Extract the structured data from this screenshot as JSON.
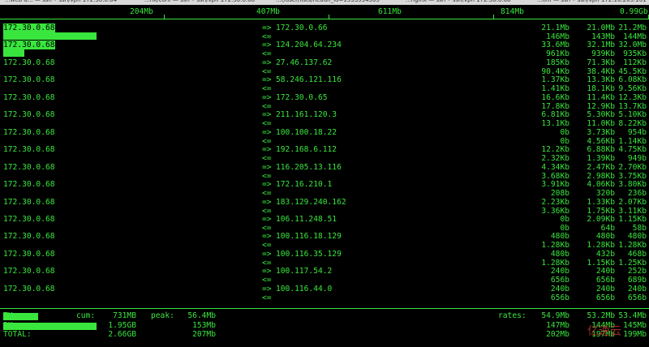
{
  "tabs": [
    "...web-a... — ssh • ssh/vpn 172.30.0.64",
    "...nx/conf — ssh • ssh/vpn 172.30.0.68",
    "...(/user/lists/headn_id=1533534305",
    "...nginx — ssh • ssh/vpn 172.30.0.68",
    "...onf — ssh • ssh/vpn 172.16.209.101"
  ],
  "scale": [
    "204Mb",
    "407Mb",
    "611Mb",
    "814Mb",
    "0.99Gb"
  ],
  "arrows": {
    "out": "=>",
    "in": "<="
  },
  "hosts": [
    {
      "src": "172.30.0.68",
      "dst": "172.30.0.66",
      "tx": [
        "21.1Mb",
        "21.0Mb",
        "21.2Mb"
      ],
      "rx": [
        "146Mb",
        "143Mb",
        "144Mb"
      ],
      "bar": 0.144
    },
    {
      "src": "172.30.0.68",
      "dst": "124.204.64.234",
      "tx": [
        "33.6Mb",
        "32.1Mb",
        "32.0Mb"
      ],
      "rx": [
        "961Kb",
        "939Kb",
        "935Kb"
      ],
      "bar": 0.033
    },
    {
      "src": "172.30.0.68",
      "dst": "27.46.137.62",
      "tx": [
        "185Kb",
        "71.3Kb",
        "112Kb"
      ],
      "rx": [
        "90.4Kb",
        "38.4Kb",
        "45.5Kb"
      ],
      "bar": 0
    },
    {
      "src": "172.30.0.68",
      "dst": "58.246.121.116",
      "tx": [
        "1.37Kb",
        "13.3Kb",
        "6.08Kb"
      ],
      "rx": [
        "1.41Kb",
        "18.1Kb",
        "9.56Kb"
      ],
      "bar": 0
    },
    {
      "src": "172.30.0.68",
      "dst": "172.30.0.65",
      "tx": [
        "16.6Kb",
        "11.4Kb",
        "12.3Kb"
      ],
      "rx": [
        "17.8Kb",
        "12.9Kb",
        "13.7Kb"
      ],
      "bar": 0
    },
    {
      "src": "172.30.0.68",
      "dst": "211.161.120.3",
      "tx": [
        "6.81Kb",
        "5.30Kb",
        "5.10Kb"
      ],
      "rx": [
        "13.1Kb",
        "11.0Kb",
        "8.22Kb"
      ],
      "bar": 0
    },
    {
      "src": "172.30.0.68",
      "dst": "100.100.18.22",
      "tx": [
        "0b",
        "3.73Kb",
        "954b"
      ],
      "rx": [
        "0b",
        "4.56Kb",
        "1.14Kb"
      ],
      "bar": 0
    },
    {
      "src": "172.30.0.68",
      "dst": "192.168.6.112",
      "tx": [
        "12.2Kb",
        "6.88Kb",
        "4.75Kb"
      ],
      "rx": [
        "2.32Kb",
        "1.39Kb",
        "949b"
      ],
      "bar": 0
    },
    {
      "src": "172.30.0.68",
      "dst": "116.205.13.116",
      "tx": [
        "4.34Kb",
        "2.47Kb",
        "2.70Kb"
      ],
      "rx": [
        "3.68Kb",
        "2.98Kb",
        "3.75Kb"
      ],
      "bar": 0
    },
    {
      "src": "172.30.0.68",
      "dst": "172.16.210.1",
      "tx": [
        "3.91Kb",
        "4.06Kb",
        "3.80Kb"
      ],
      "rx": [
        "208b",
        "320b",
        "236b"
      ],
      "bar": 0
    },
    {
      "src": "172.30.0.68",
      "dst": "183.129.240.162",
      "tx": [
        "2.23Kb",
        "1.33Kb",
        "2.07Kb"
      ],
      "rx": [
        "3.36Kb",
        "1.75Kb",
        "3.11Kb"
      ],
      "bar": 0
    },
    {
      "src": "172.30.0.68",
      "dst": "106.11.248.51",
      "tx": [
        "0b",
        "2.09Kb",
        "1.15Kb"
      ],
      "rx": [
        "0b",
        "64b",
        "58b"
      ],
      "bar": 0
    },
    {
      "src": "172.30.0.68",
      "dst": "100.116.18.129",
      "tx": [
        "480b",
        "480b",
        "480b"
      ],
      "rx": [
        "1.28Kb",
        "1.28Kb",
        "1.28Kb"
      ],
      "bar": 0
    },
    {
      "src": "172.30.0.68",
      "dst": "100.116.35.129",
      "tx": [
        "480b",
        "432b",
        "468b"
      ],
      "rx": [
        "1.28Kb",
        "1.15Kb",
        "1.25Kb"
      ],
      "bar": 0
    },
    {
      "src": "172.30.0.68",
      "dst": "100.117.54.2",
      "tx": [
        "240b",
        "240b",
        "252b"
      ],
      "rx": [
        "656b",
        "656b",
        "689b"
      ],
      "bar": 0
    },
    {
      "src": "172.30.0.68",
      "dst": "100.116.44.0",
      "tx": [
        "240b",
        "240b",
        "240b"
      ],
      "rx": [
        "656b",
        "656b",
        "656b"
      ],
      "bar": 0
    }
  ],
  "footer": {
    "tx_label": "TX:",
    "rx_label": "RX:",
    "total_label": "TOTAL:",
    "cum_label": "cum:",
    "peak_label": "peak:",
    "rates_label": "rates:",
    "tx_cum": "731MB",
    "rx_cum": "1.95GB",
    "total_cum": "2.66GB",
    "tx_peak": "56.4Mb",
    "rx_peak": "153Mb",
    "total_peak": "207Mb",
    "tx_rates": [
      "54.9Mb",
      "53.2Mb",
      "53.4Mb"
    ],
    "rx_rates": [
      "147Mb",
      "144Mb",
      "145Mb"
    ],
    "total_rates": [
      "202Mb",
      "197Mb",
      "199Mb"
    ],
    "tx_bar": 0.054,
    "rx_bar": 0.144
  },
  "watermark": "亿速云"
}
